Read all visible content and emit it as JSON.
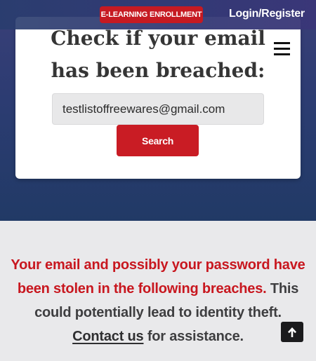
{
  "header": {
    "enroll_label": "E-LEARNING ENROLLMENT",
    "login_label": "Login/Register"
  },
  "checker": {
    "title": "Check if your email has been breached:",
    "email_value": "testlistoffreewares@gmail.com",
    "search_label": "Search",
    "menu_icon": "hamburger-menu-icon"
  },
  "result": {
    "red_text": "Your email and possibly your password have been stolen in the following breaches.",
    "dark_text_1": "This could potentially lead to identity theft.",
    "contact_link": "Contact us",
    "dark_text_2": "for assistance."
  },
  "scroll_top": {
    "icon": "arrow-up-icon"
  },
  "colors": {
    "accent_red": "#c91c24",
    "hero_blue": "#2c3c72",
    "panel_gray": "#e9e9eb"
  }
}
